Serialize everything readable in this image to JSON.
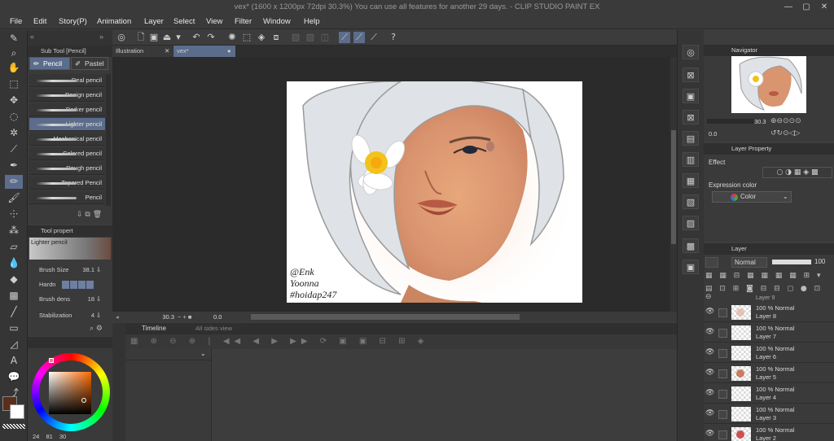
{
  "window": {
    "title": "vex* (1600 x 1200px 72dpi 30.3%)  You can use all features for another 29 days. - CLIP STUDIO PAINT EX"
  },
  "menu": [
    "File",
    "Edit",
    "Story(P)",
    "Animation",
    "Layer",
    "Select",
    "View",
    "Filter",
    "Window",
    "Help"
  ],
  "subtool": {
    "panel_title": "Sub Tool [Pencil]",
    "tabs": [
      "Pencil",
      "Pastel"
    ],
    "brushes": [
      "Real pencil",
      "Design pencil",
      "Darker pencil",
      "Lighter pencil",
      "Mechanical pencil",
      "Colored pencil",
      "Rough pencil",
      "Tapered Pencil",
      "Pencil"
    ],
    "selected": "Lighter pencil"
  },
  "toolprop": {
    "panel_title": "Tool propert",
    "brush_name": "Lighter pencil",
    "brush_size_label": "Brush Size",
    "brush_size": "38.1",
    "hardness_label": "Hardn",
    "density_label": "Brush dens",
    "density": "18",
    "stabilization_label": "Stabilization",
    "stabilization": "4"
  },
  "color": {
    "main": "#5a2e18",
    "sub": "#ffffff",
    "hsv": [
      "24",
      "81",
      "30"
    ]
  },
  "document": {
    "tabs": [
      "Illustration",
      "vex*"
    ],
    "zoom": "30.3",
    "angle": "0.0",
    "signature": [
      "@Enk",
      "Yoonna",
      "#hoidap247"
    ]
  },
  "timeline": {
    "title": "Timeline",
    "subtitle": "All sides view"
  },
  "navigator": {
    "title": "Navigator",
    "zoom": "30.3",
    "angle": "0.0"
  },
  "layerprop": {
    "title": "Layer Property",
    "effect_label": "Effect",
    "expression_label": "Expression color",
    "expression_value": "Color"
  },
  "layers": {
    "title": "Layer",
    "blend_mode": "Normal",
    "opacity": "100",
    "top_label": "Layer 9",
    "items": [
      {
        "mode": "100 % Normal",
        "name": "Layer 8",
        "accent": "#e1b9a4"
      },
      {
        "mode": "100 % Normal",
        "name": "Layer 7",
        "accent": ""
      },
      {
        "mode": "100 % Normal",
        "name": "Layer 6",
        "accent": ""
      },
      {
        "mode": "100 % Normal",
        "name": "Layer 5",
        "accent": "#c06040"
      },
      {
        "mode": "100 % Normal",
        "name": "Layer 4",
        "accent": ""
      },
      {
        "mode": "100 % Normal",
        "name": "Layer 3",
        "accent": ""
      },
      {
        "mode": "100 % Normal",
        "name": "Layer 2",
        "accent": "#c62828"
      }
    ]
  },
  "colors": {
    "accent": "#5c6d8c",
    "panel": "#3a3a3a",
    "dark": "#2b2b2b"
  }
}
